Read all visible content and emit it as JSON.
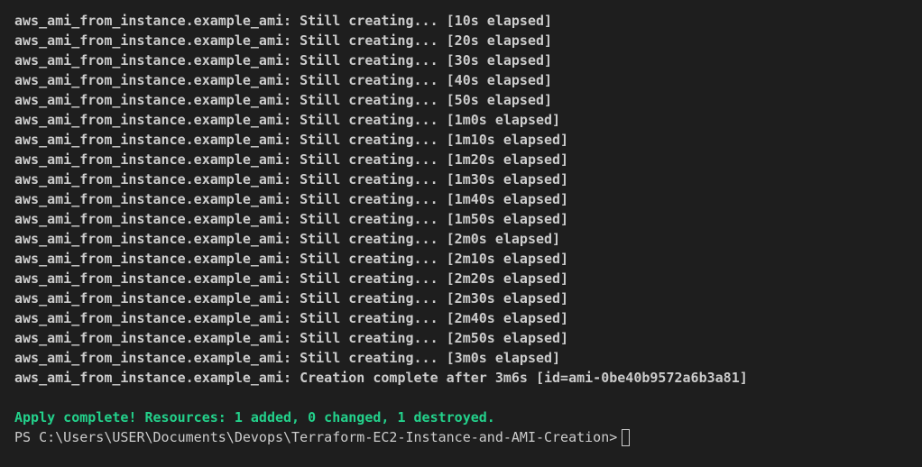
{
  "terminal": {
    "lines": [
      "aws_ami_from_instance.example_ami: Still creating... [10s elapsed]",
      "aws_ami_from_instance.example_ami: Still creating... [20s elapsed]",
      "aws_ami_from_instance.example_ami: Still creating... [30s elapsed]",
      "aws_ami_from_instance.example_ami: Still creating... [40s elapsed]",
      "aws_ami_from_instance.example_ami: Still creating... [50s elapsed]",
      "aws_ami_from_instance.example_ami: Still creating... [1m0s elapsed]",
      "aws_ami_from_instance.example_ami: Still creating... [1m10s elapsed]",
      "aws_ami_from_instance.example_ami: Still creating... [1m20s elapsed]",
      "aws_ami_from_instance.example_ami: Still creating... [1m30s elapsed]",
      "aws_ami_from_instance.example_ami: Still creating... [1m40s elapsed]",
      "aws_ami_from_instance.example_ami: Still creating... [1m50s elapsed]",
      "aws_ami_from_instance.example_ami: Still creating... [2m0s elapsed]",
      "aws_ami_from_instance.example_ami: Still creating... [2m10s elapsed]",
      "aws_ami_from_instance.example_ami: Still creating... [2m20s elapsed]",
      "aws_ami_from_instance.example_ami: Still creating... [2m30s elapsed]",
      "aws_ami_from_instance.example_ami: Still creating... [2m40s elapsed]",
      "aws_ami_from_instance.example_ami: Still creating... [2m50s elapsed]",
      "aws_ami_from_instance.example_ami: Still creating... [3m0s elapsed]",
      "aws_ami_from_instance.example_ami: Creation complete after 3m6s [id=ami-0be40b9572a6b3a81]"
    ],
    "apply_summary": "Apply complete! Resources: 1 added, 0 changed, 1 destroyed.",
    "prompt": "PS C:\\Users\\USER\\Documents\\Devops\\Terraform-EC2-Instance-and-AMI-Creation>",
    "colors": {
      "background": "#1e1e1e",
      "text": "#cccccc",
      "success": "#23d18b"
    }
  }
}
